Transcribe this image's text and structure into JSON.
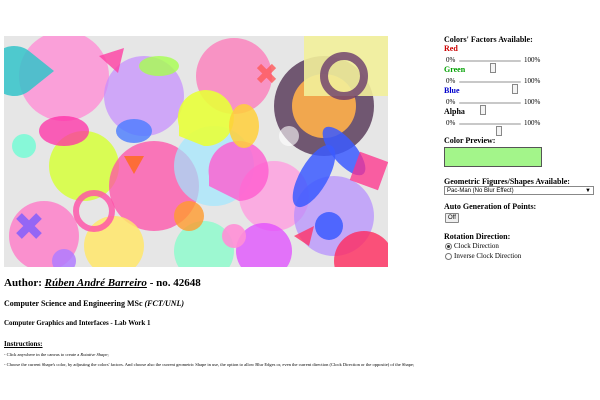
{
  "panel": {
    "colors_title": "Colors' Factors Available:",
    "red_label": "Red",
    "green_label": "Green",
    "blue_label": "Blue",
    "alpha_label": "Alpha",
    "min_label": "0%",
    "max_label": "100%",
    "red_value": 0.55,
    "green_value": 0.9,
    "blue_value": 0.38,
    "alpha_value": 0.65,
    "preview_title": "Color Preview:",
    "preview_color": "#a3f58a",
    "shapes_title": "Geometric Figures/Shapes Available:",
    "shape_selected": "Pac-Man (No Blur Effect)",
    "auto_title": "Auto Generation of Points:",
    "auto_button": "Off",
    "rotation_title": "Rotation Direction:",
    "rotation_clock": "Clock Direction",
    "rotation_inverse": "Inverse Clock Direction"
  },
  "footer": {
    "author_prefix": "Author:",
    "author_name": "Rúben André Barreiro",
    "author_suffix": "- no. 42648",
    "degree": "Computer Science and Engineering MSc",
    "degree_inst": "(FCT/UNL)",
    "course": "Computer Graphics and Interfaces - Lab Work 1",
    "instructions_title": "Instructions:",
    "instr_1_a": "- Click anywhere in the canvas to create a",
    "instr_1_b": "Rotative Shape",
    "instr_1_c": ";",
    "instr_2": "- Choose the current Shape's color, by adjusting the colors' factors. And choose also the current geometric Shape in use, the option to allow Blur Edges or, even the current direction (Clock Direction or the opposite) of the Shape;"
  },
  "colors": {
    "canvas_bg": "#e8e8e8",
    "red_label": "#cc0000",
    "green_label": "#00a000",
    "blue_label": "#0000cc"
  }
}
